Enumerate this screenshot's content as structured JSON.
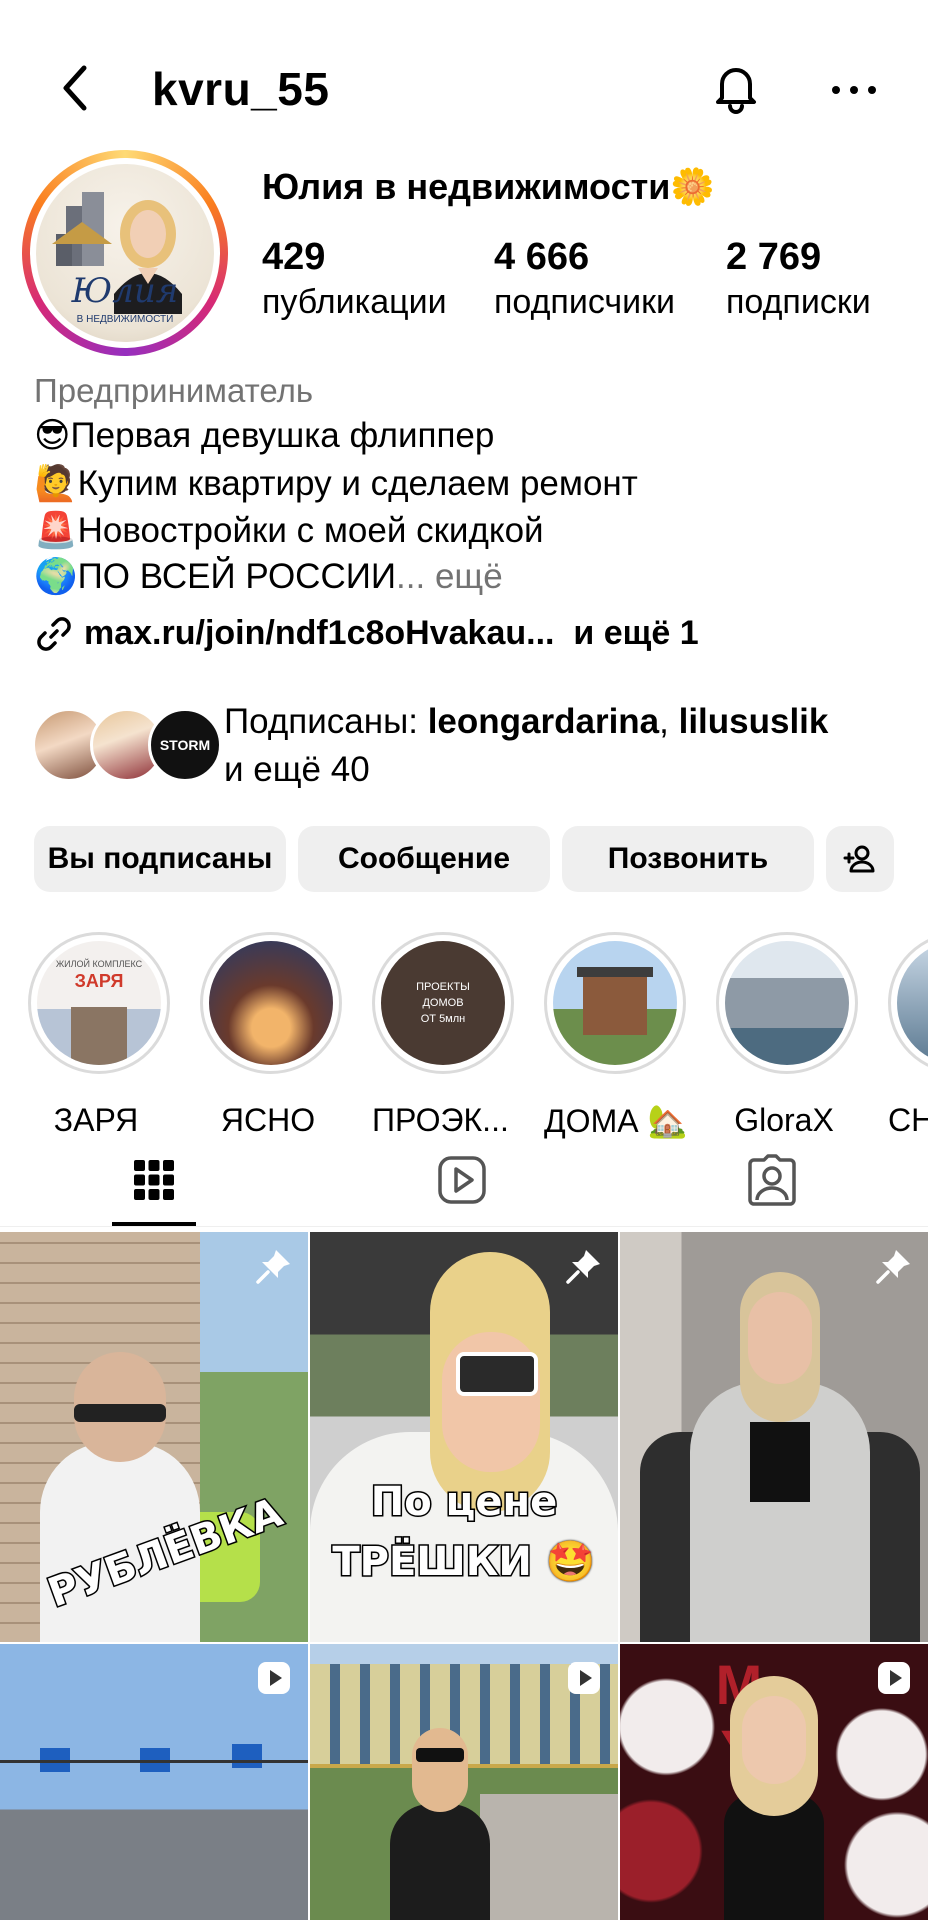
{
  "header": {
    "username": "kvru_55",
    "back_icon": "chevron-left-icon",
    "bell_icon": "bell-icon",
    "more_icon": "more-horizontal-icon"
  },
  "profile": {
    "display_name": "Юлия в недвижимости🌼",
    "avatar_text_main": "Юлия",
    "avatar_text_sub": "В НЕДВИЖИМОСТИ",
    "stats": [
      {
        "value": "429",
        "label": "публикации"
      },
      {
        "value": "4 666",
        "label": "подписчики"
      },
      {
        "value": "2 769",
        "label": "подписки"
      }
    ]
  },
  "bio": {
    "category": "Предприниматель",
    "lines": [
      {
        "emoji": "😎",
        "text": "Первая девушка флиппер"
      },
      {
        "emoji": "🙋",
        "text": "Купим квартиру и сделаем ремонт"
      },
      {
        "emoji": "🚨",
        "text": "Новостройки с моей скидкой"
      },
      {
        "emoji": "🌍",
        "text": "ПО ВСЕЙ РОССИИ"
      }
    ],
    "more": "... ещё",
    "link": "max.ru/join/ndf1c8oHvakau...",
    "link_more": "и ещё 1"
  },
  "followed_by": {
    "prefix": "Подписаны: ",
    "user1": "leongardarina",
    "sep": ", ",
    "user2": "lilususlik",
    "suffix": "и ещё 40",
    "third_avatar_text": "STORM"
  },
  "buttons": {
    "following": "Вы подписаны",
    "message": "Сообщение",
    "call": "Позвонить",
    "add_user_icon": "add-user-icon"
  },
  "highlights": [
    {
      "label": "ЗАРЯ",
      "img_top": "ЖИЛОЙ КОМПЛЕКС",
      "img_title": "ЗАРЯ"
    },
    {
      "label": "ЯСНО"
    },
    {
      "label": "ПРОЭК...",
      "img_text": [
        "ПРОЕКТЫ",
        "ДОМОВ",
        "ОТ 5млн"
      ]
    },
    {
      "label": "ДОМА 🏡"
    },
    {
      "label": "GloraX"
    },
    {
      "label": "СН"
    }
  ],
  "tabs": [
    {
      "name": "grid",
      "icon": "grid-icon",
      "active": true
    },
    {
      "name": "reels",
      "icon": "reels-icon",
      "active": false
    },
    {
      "name": "tagged",
      "icon": "tagged-icon",
      "active": false
    }
  ],
  "posts": [
    {
      "badge": "pin-icon",
      "caption": "РУБЛЁВКА"
    },
    {
      "badge": "pin-icon",
      "caption_line1": "По цене",
      "caption_line2": "ТРЁШКИ 🤩"
    },
    {
      "badge": "pin-icon"
    },
    {
      "badge": "reels-icon"
    },
    {
      "badge": "reels-icon"
    },
    {
      "badge": "reels-icon",
      "letters": "M Y"
    }
  ],
  "colors": {
    "text": "#000000",
    "muted": "#737373",
    "button_bg": "#efefef",
    "ring": "#d62976"
  }
}
